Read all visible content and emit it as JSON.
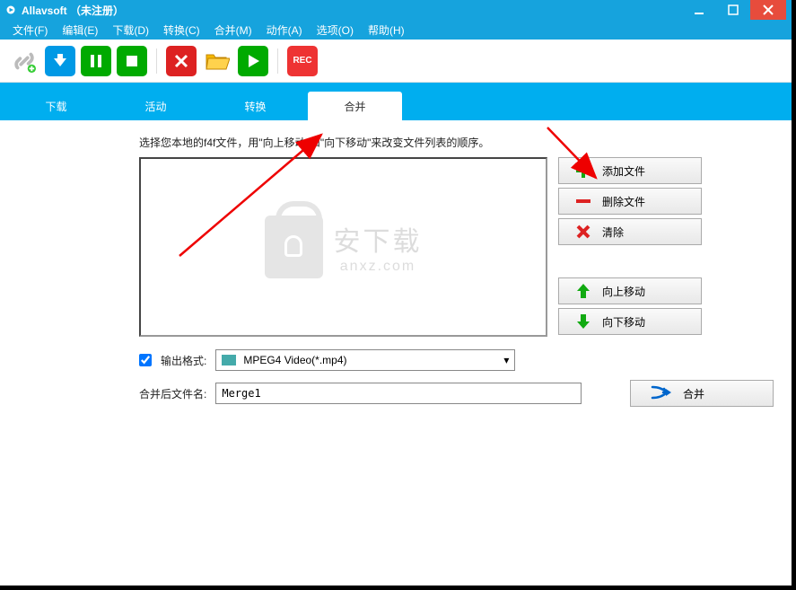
{
  "title": "Allavsoft （未注册）",
  "menu": {
    "file": "文件(F)",
    "edit": "编辑(E)",
    "download": "下载(D)",
    "convert": "转换(C)",
    "merge": "合并(M)",
    "action": "动作(A)",
    "options": "选项(O)",
    "help": "帮助(H)"
  },
  "toolbar": {
    "rec": "REC"
  },
  "tabs": {
    "download": "下载",
    "activity": "活动",
    "convert": "转换",
    "merge": "合并"
  },
  "main": {
    "instruction": "选择您本地的f4f文件，用\"向上移动\"和\"向下移动\"来改变文件列表的顺序。",
    "watermark_main": "安下载",
    "watermark_sub": "anxz.com",
    "add_file": "添加文件",
    "delete_file": "删除文件",
    "clear": "清除",
    "move_up": "向上移动",
    "move_down": "向下移动",
    "output_format_label": "输出格式:",
    "output_format_value": "MPEG4 Video(*.mp4)",
    "merged_name_label": "合并后文件名:",
    "merged_name_value": "Merge1",
    "merge_btn": "合并"
  }
}
